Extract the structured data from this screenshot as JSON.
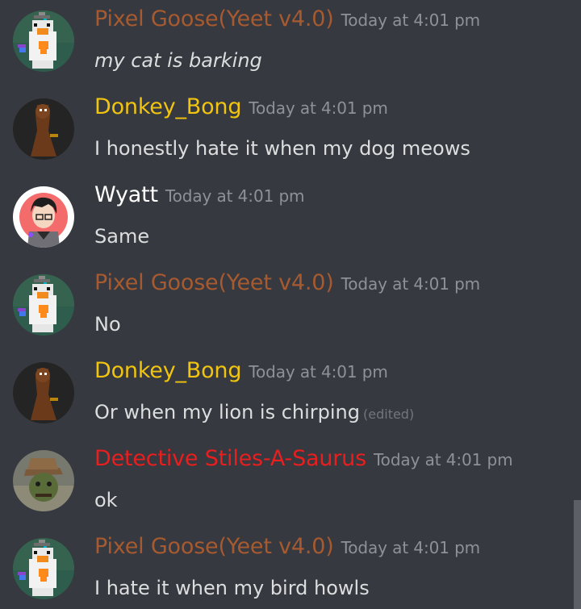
{
  "colors": {
    "background": "#36393f",
    "message_text": "#dcddde",
    "timestamp": "#8e9297",
    "edited": "#72767d"
  },
  "messages": [
    {
      "author": "Pixel Goose(Yeet v4.0)",
      "author_color": "#a75a2f",
      "timestamp": "Today at 4:01 pm",
      "text": "my cat is barking",
      "avatar_icon": "pixel-goose-avatar"
    },
    {
      "author": "Donkey_Bong",
      "author_color": "#f1c40f",
      "timestamp": "Today at 4:01 pm",
      "text": "I honestly hate it when my dog meows",
      "avatar_icon": "donkey-avatar"
    },
    {
      "author": "Wyatt",
      "author_color": "#ffffff",
      "timestamp": "Today at 4:01 pm",
      "text": "Same",
      "avatar_icon": "anime-boy-avatar"
    },
    {
      "author": "Pixel Goose(Yeet v4.0)",
      "author_color": "#a75a2f",
      "timestamp": "Today at 4:01 pm",
      "text": "No",
      "avatar_icon": "pixel-goose-avatar"
    },
    {
      "author": "Donkey_Bong",
      "author_color": "#f1c40f",
      "timestamp": "Today at 4:01 pm",
      "text": "Or when my lion is chirping",
      "edited": "(edited)",
      "avatar_icon": "donkey-avatar"
    },
    {
      "author": "Detective Stiles-A-Saurus",
      "author_color": "#e91e1e",
      "timestamp": "Today at 4:01 pm",
      "text": "ok",
      "avatar_icon": "detective-avatar"
    },
    {
      "author": "Pixel Goose(Yeet v4.0)",
      "author_color": "#a75a2f",
      "timestamp": "Today at 4:01 pm",
      "text": "I hate it when my bird howls",
      "avatar_icon": "pixel-goose-avatar"
    }
  ]
}
